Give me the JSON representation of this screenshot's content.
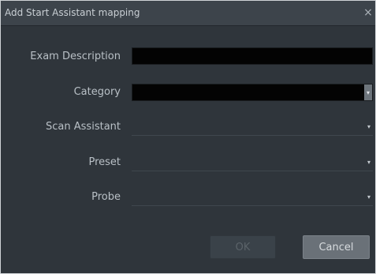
{
  "dialog": {
    "title": "Add Start Assistant mapping",
    "close_label": "×"
  },
  "form": {
    "exam_description": {
      "label": "Exam Description",
      "value": ""
    },
    "category": {
      "label": "Category",
      "value": ""
    },
    "scan_assistant": {
      "label": "Scan Assistant",
      "value": ""
    },
    "preset": {
      "label": "Preset",
      "value": ""
    },
    "probe": {
      "label": "Probe",
      "value": ""
    },
    "dropdown_arrow": "▾"
  },
  "buttons": {
    "ok": "OK",
    "cancel": "Cancel"
  },
  "colors": {
    "dialog_background": "#2f353b",
    "titlebar": "#3d444b",
    "text_field_background": "#030303",
    "cancel_button": "#6a7178"
  }
}
